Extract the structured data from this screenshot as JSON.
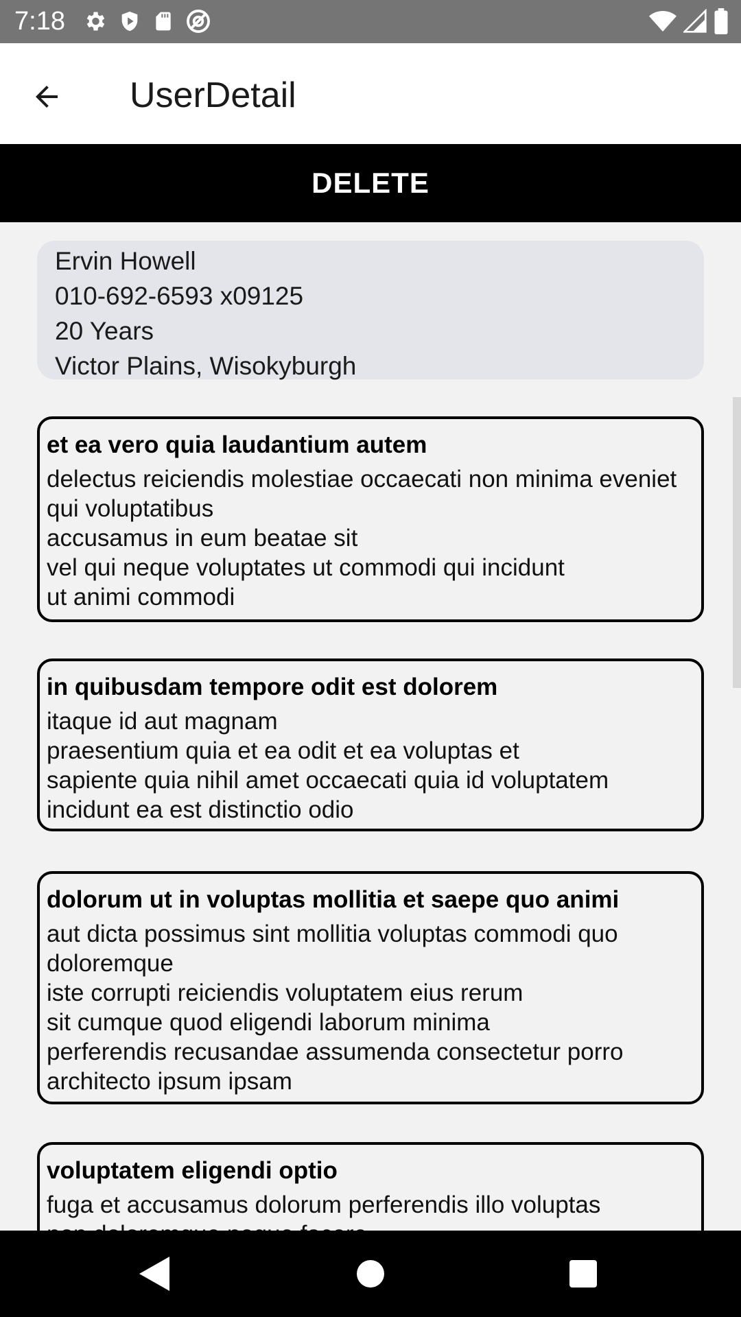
{
  "status_bar": {
    "time": "7:18",
    "left_icons": [
      "gear-icon",
      "shield-icon",
      "sd-card-icon",
      "at-sign-icon"
    ],
    "right_icons": [
      "wifi-icon",
      "cell-signal-icon",
      "battery-icon"
    ]
  },
  "app_bar": {
    "title": "UserDetail",
    "back_icon": "arrow-back-icon"
  },
  "delete_button": {
    "label": "DELETE"
  },
  "user": {
    "name": "Ervin Howell",
    "phone": "010-692-6593 x09125",
    "age": "20 Years",
    "address": "Victor Plains, Wisokyburgh"
  },
  "posts": [
    {
      "title": "et ea vero quia laudantium autem",
      "body": "delectus reiciendis molestiae occaecati non minima eveniet qui voluptatibus\naccusamus in eum beatae sit\nvel qui neque voluptates ut commodi qui incidunt\nut animi commodi"
    },
    {
      "title": "in quibusdam tempore odit est dolorem",
      "body": "itaque id aut magnam\npraesentium quia et ea odit et ea voluptas et\nsapiente quia nihil amet occaecati quia id voluptatem\nincidunt ea est distinctio odio"
    },
    {
      "title": "dolorum ut in voluptas mollitia et saepe quo animi",
      "body": "aut dicta possimus sint mollitia voluptas commodi quo doloremque\niste corrupti reiciendis voluptatem eius rerum\nsit cumque quod eligendi laborum minima\nperferendis recusandae assumenda consectetur porro architecto ipsum ipsam"
    },
    {
      "title": "voluptatem eligendi optio",
      "body": "fuga et accusamus dolorum perferendis illo voluptas\nnon doloremque neque facere"
    }
  ],
  "nav_bar": {
    "icons": [
      "back-triangle-icon",
      "home-circle-icon",
      "recents-square-icon"
    ]
  },
  "colors": {
    "status_bar": "#757575",
    "app_bar": "#ffffff",
    "delete_bar": "#000000",
    "user_card": "#e4e5ea",
    "background": "#f2f2f2"
  }
}
